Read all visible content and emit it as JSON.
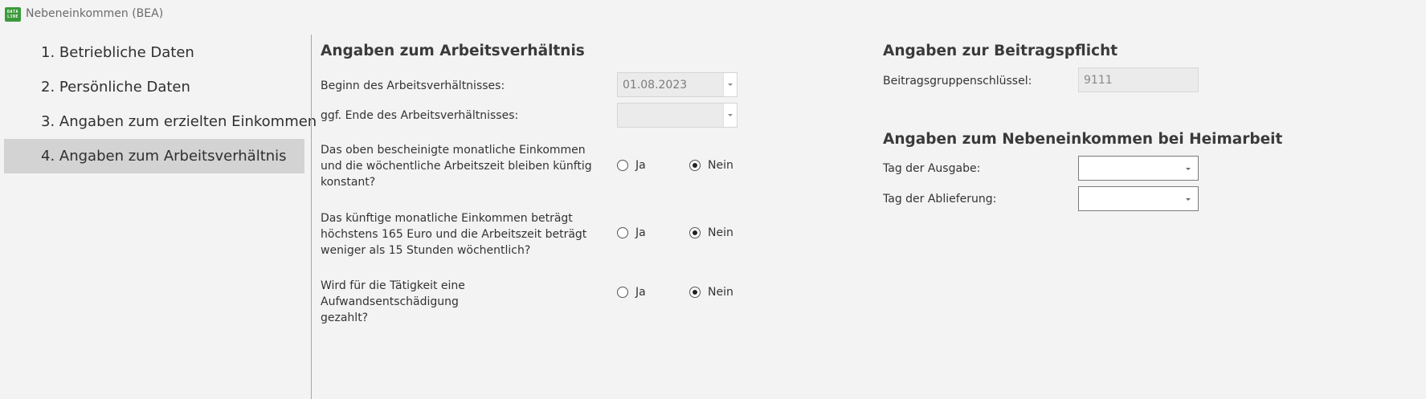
{
  "window": {
    "title": "Nebeneinkommen (BEA)",
    "icon_lines": [
      "DATA",
      "LINE"
    ]
  },
  "sidebar": {
    "items": [
      {
        "label": "1. Betriebliche Daten",
        "active": false
      },
      {
        "label": "2. Persönliche Daten",
        "active": false
      },
      {
        "label": "3. Angaben zum erzielten Einkommen",
        "active": false
      },
      {
        "label": "4. Angaben zum Arbeitsverhältnis",
        "active": true
      }
    ]
  },
  "employment": {
    "heading": "Angaben zum Arbeitsverhältnis",
    "start_label": "Beginn des Arbeitsverhältnisses:",
    "start_value": "01.08.2023",
    "end_label": "ggf. Ende des Arbeitsverhältnisses:",
    "end_value": "",
    "questions": [
      {
        "lines": [
          "Das oben bescheinigte monatliche Einkommen",
          "und die wöchentliche Arbeitszeit bleiben künftig",
          "konstant?"
        ],
        "yes_label": "Ja",
        "no_label": "Nein",
        "selected": "no"
      },
      {
        "lines": [
          "Das künftige monatliche Einkommen beträgt",
          "höchstens 165 Euro und die Arbeitszeit beträgt",
          "weniger als 15 Stunden wöchentlich?"
        ],
        "yes_label": "Ja",
        "no_label": "Nein",
        "selected": "no"
      },
      {
        "lines": [
          "Wird für die Tätigkeit eine Aufwandsentschädigung",
          "gezahlt?"
        ],
        "yes_label": "Ja",
        "no_label": "Nein",
        "selected": "no"
      }
    ]
  },
  "contribution": {
    "heading": "Angaben zur Beitragspflicht",
    "key_label": "Beitragsgruppenschlüssel:",
    "key_value": "9111"
  },
  "homework": {
    "heading": "Angaben zum Nebeneinkommen bei Heimarbeit",
    "issue_label": "Tag der Ausgabe:",
    "issue_value": "",
    "delivery_label": "Tag der Ablieferung:",
    "delivery_value": ""
  },
  "colors": {
    "background": "#f3f3f3",
    "active_nav": "#d3d3d3",
    "icon_green": "#3a9a3a"
  }
}
